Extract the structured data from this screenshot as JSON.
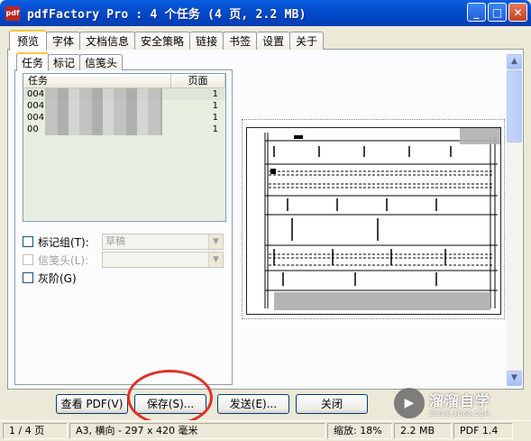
{
  "window": {
    "icon_text": "pdf",
    "title": "pdfFactory Pro : 4 个任务 (4 页, 2.2 MB)",
    "minimize": "_",
    "maximize": "□",
    "close": "✕"
  },
  "tabs": [
    "预览",
    "字体",
    "文档信息",
    "安全策略",
    "链接",
    "书签",
    "设置",
    "关于"
  ],
  "subtabs": [
    "任务",
    "标记",
    "信笺头"
  ],
  "task_list": {
    "headers": [
      "任务",
      "页面"
    ],
    "rows": [
      {
        "name": "004",
        "page": "1"
      },
      {
        "name": "004",
        "page": "1"
      },
      {
        "name": "004",
        "page": "1"
      },
      {
        "name": "00",
        "page": "1"
      }
    ]
  },
  "options": {
    "mark_group_label": "标记组(T):",
    "mark_group_value": "草稿",
    "letterhead_label": "信笺头(L):",
    "letterhead_value": "",
    "grayscale_label": "灰阶(G)"
  },
  "buttons": {
    "view_pdf": "查看 PDF(V)",
    "save": "保存(S)...",
    "send": "发送(E)...",
    "close": "关闭"
  },
  "status": {
    "page": "1 / 4 页",
    "paper": "A3, 横向 - 297 x 420 毫米",
    "zoom": "缩放: 18%",
    "size": "2.2 MB",
    "version": "PDF 1.4"
  },
  "watermark": {
    "brand": "溜溜自学",
    "url": "ZIXUE.3D66.COM"
  },
  "colors": {
    "titlebar": "#0550d0",
    "annotation": "#e0322a",
    "tab_highlight": "#ffc83c"
  }
}
